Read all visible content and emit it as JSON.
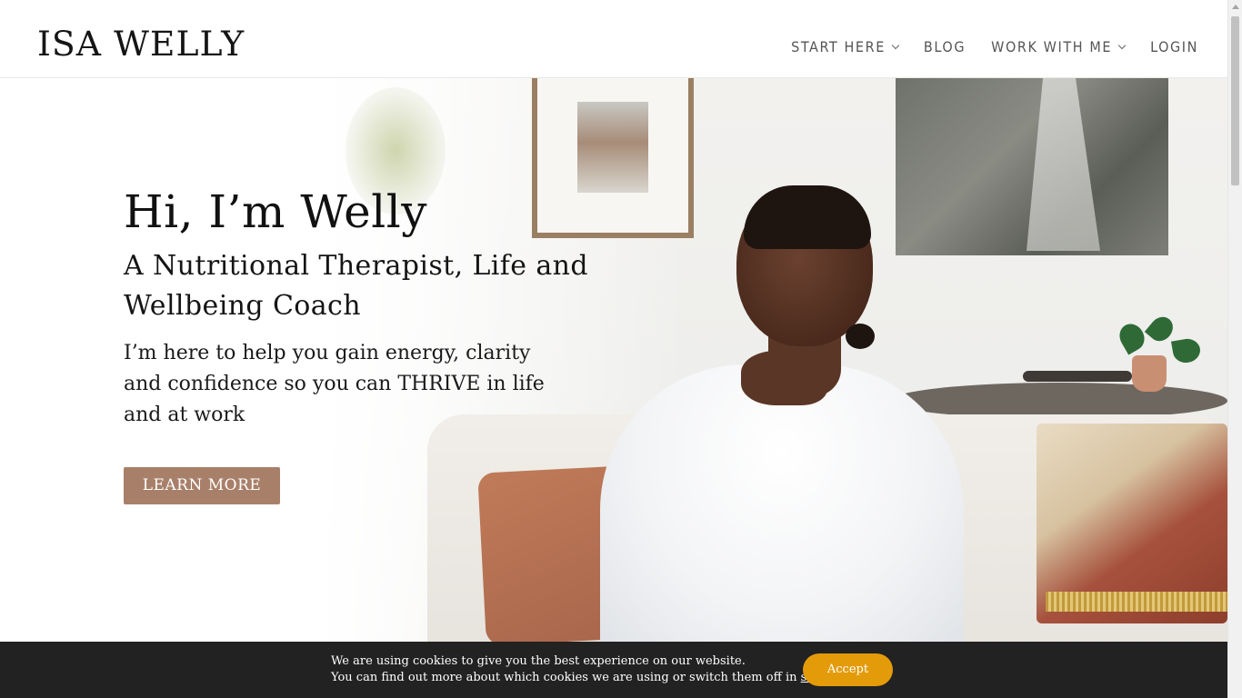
{
  "header": {
    "logo": "ISA WELLY",
    "nav": [
      {
        "label": "START HERE",
        "has_dropdown": true
      },
      {
        "label": "BLOG",
        "has_dropdown": false
      },
      {
        "label": "WORK WITH ME",
        "has_dropdown": true
      },
      {
        "label": "LOGIN",
        "has_dropdown": false
      }
    ]
  },
  "hero": {
    "title": "Hi, I’m Welly",
    "subtitle": "A Nutritional Therapist, Life and Wellbeing Coach",
    "text": "I’m here to help you gain energy, clarity and confidence so you can THRIVE in life and at work",
    "button_label": "LEARN MORE"
  },
  "cookie_bar": {
    "line1": "We are using cookies to give you the best experience on our website.",
    "line2_prefix": "You can find out more about which cookies we are using or switch them off in ",
    "line2_link": "settings",
    "line2_suffix": ".",
    "accept_label": "Accept"
  },
  "colors": {
    "button": "#a8806a",
    "accept": "#e39b0a",
    "cookie_bg": "#222222"
  }
}
